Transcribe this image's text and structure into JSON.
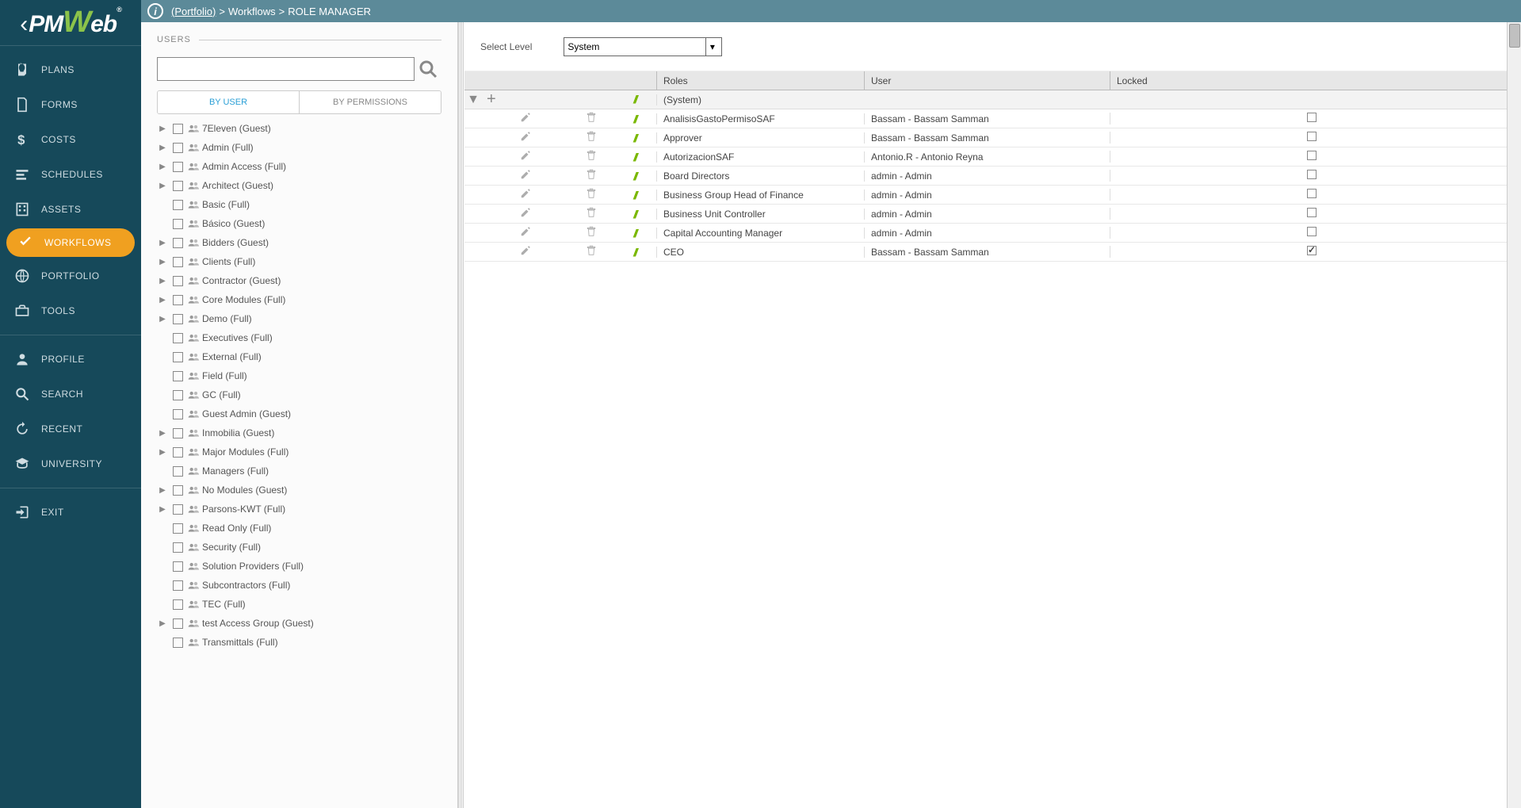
{
  "logo": {
    "text": "PMWeb"
  },
  "breadcrumb": {
    "portfolio": "(Portfolio)",
    "workflows": "Workflows",
    "page": "ROLE MANAGER"
  },
  "nav": {
    "items": [
      {
        "id": "plans",
        "label": "PLANS"
      },
      {
        "id": "forms",
        "label": "FORMS"
      },
      {
        "id": "costs",
        "label": "COSTS"
      },
      {
        "id": "schedules",
        "label": "SCHEDULES"
      },
      {
        "id": "assets",
        "label": "ASSETS"
      },
      {
        "id": "workflows",
        "label": "WORKFLOWS",
        "active": true
      },
      {
        "id": "portfolio",
        "label": "PORTFOLIO"
      },
      {
        "id": "tools",
        "label": "TOOLS"
      }
    ],
    "items2": [
      {
        "id": "profile",
        "label": "PROFILE"
      },
      {
        "id": "search",
        "label": "SEARCH"
      },
      {
        "id": "recent",
        "label": "RECENT"
      },
      {
        "id": "university",
        "label": "UNIVERSITY"
      }
    ],
    "items3": [
      {
        "id": "exit",
        "label": "EXIT"
      }
    ]
  },
  "users_panel": {
    "title": "USERS",
    "search_placeholder": "",
    "tabs": {
      "by_user": "BY USER",
      "by_permissions": "BY PERMISSIONS"
    },
    "list": [
      {
        "label": "7Eleven (Guest)",
        "caret": true
      },
      {
        "label": "Admin (Full)",
        "caret": true
      },
      {
        "label": "Admin Access (Full)",
        "caret": true
      },
      {
        "label": "Architect (Guest)",
        "caret": true
      },
      {
        "label": "Basic (Full)",
        "caret": false
      },
      {
        "label": "Básico (Guest)",
        "caret": false
      },
      {
        "label": "Bidders (Guest)",
        "caret": true
      },
      {
        "label": "Clients (Full)",
        "caret": true
      },
      {
        "label": "Contractor (Guest)",
        "caret": true
      },
      {
        "label": "Core Modules (Full)",
        "caret": true
      },
      {
        "label": "Demo (Full)",
        "caret": true
      },
      {
        "label": "Executives (Full)",
        "caret": false
      },
      {
        "label": "External (Full)",
        "caret": false
      },
      {
        "label": "Field (Full)",
        "caret": false
      },
      {
        "label": "GC (Full)",
        "caret": false
      },
      {
        "label": "Guest Admin (Guest)",
        "caret": false
      },
      {
        "label": "Inmobilia (Guest)",
        "caret": true
      },
      {
        "label": "Major Modules (Full)",
        "caret": true
      },
      {
        "label": "Managers (Full)",
        "caret": false
      },
      {
        "label": "No Modules (Guest)",
        "caret": true
      },
      {
        "label": "Parsons-KWT (Full)",
        "caret": true
      },
      {
        "label": "Read Only (Full)",
        "caret": false
      },
      {
        "label": "Security (Full)",
        "caret": false
      },
      {
        "label": "Solution Providers (Full)",
        "caret": false
      },
      {
        "label": "Subcontractors (Full)",
        "caret": false
      },
      {
        "label": "TEC (Full)",
        "caret": false
      },
      {
        "label": "test Access Group (Guest)",
        "caret": true
      },
      {
        "label": "Transmittals (Full)",
        "caret": false
      }
    ]
  },
  "level": {
    "label": "Select Level",
    "value": "System"
  },
  "grid": {
    "headers": {
      "roles": "Roles",
      "user": "User",
      "locked": "Locked"
    },
    "system_row": "(System)",
    "rows": [
      {
        "role": "AnalisisGastoPermisoSAF",
        "user": "Bassam - Bassam Samman",
        "locked": false
      },
      {
        "role": "Approver",
        "user": "Bassam - Bassam Samman",
        "locked": false
      },
      {
        "role": "AutorizacionSAF",
        "user": "Antonio.R - Antonio Reyna",
        "locked": false
      },
      {
        "role": "Board Directors",
        "user": "admin - Admin",
        "locked": false
      },
      {
        "role": "Business Group Head of Finance",
        "user": "admin - Admin",
        "locked": false
      },
      {
        "role": "Business Unit Controller",
        "user": "admin - Admin",
        "locked": false
      },
      {
        "role": "Capital Accounting Manager",
        "user": "admin - Admin",
        "locked": false
      },
      {
        "role": "CEO",
        "user": "Bassam - Bassam Samman",
        "locked": true
      }
    ]
  }
}
